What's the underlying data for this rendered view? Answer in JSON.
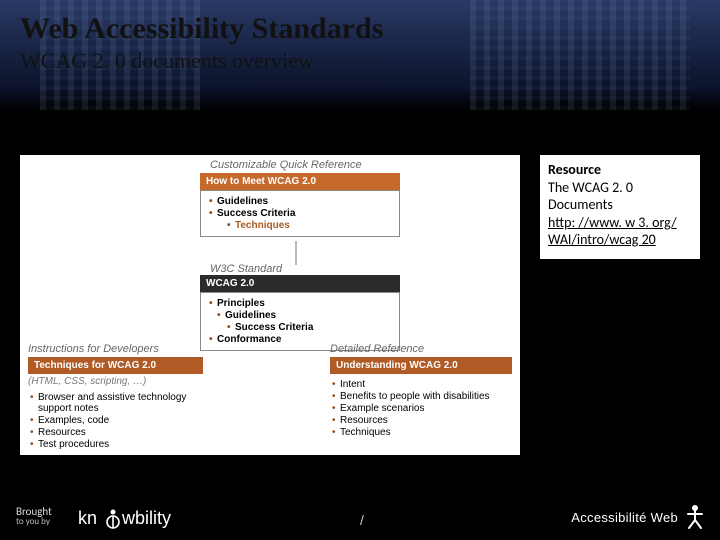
{
  "header": {
    "title": "Web Accessibility Standards",
    "subtitle": "WCAG 2. 0 documents overview"
  },
  "figure": {
    "customizable": {
      "section_label": "Customizable Quick Reference",
      "box_title": "How to Meet WCAG 2.0",
      "items": [
        "Guidelines",
        "Success Criteria"
      ],
      "sub_items": [
        "Techniques"
      ]
    },
    "w3c": {
      "section_label": "W3C Standard",
      "box_title": "WCAG 2.0",
      "items": [
        "Principles",
        "Guidelines",
        "Success Criteria",
        "Conformance"
      ]
    },
    "developers": {
      "section_label": "Instructions for Developers",
      "subnote": "(HTML, CSS, scripting, …)",
      "box_title": "Techniques for WCAG 2.0",
      "items": [
        "Browser and assistive technology support notes",
        "Examples, code",
        "Resources",
        "Test procedures"
      ]
    },
    "detailed": {
      "section_label": "Detailed Reference",
      "box_title": "Understanding WCAG 2.0",
      "items": [
        "Intent",
        "Benefits to people with disabilities",
        "Example scenarios",
        "Resources",
        "Techniques"
      ]
    }
  },
  "resource": {
    "heading": "Resource",
    "line1": "The WCAG 2. 0",
    "line2": "Documents",
    "link_text": "http: //www. w 3. org/ WAI/intro/wcag 20"
  },
  "footer": {
    "brought_line1": "Brought",
    "brought_line2": "to you by",
    "logo_know": "knowbility",
    "center": "/",
    "logo_aw": "Accessibilité Web"
  }
}
